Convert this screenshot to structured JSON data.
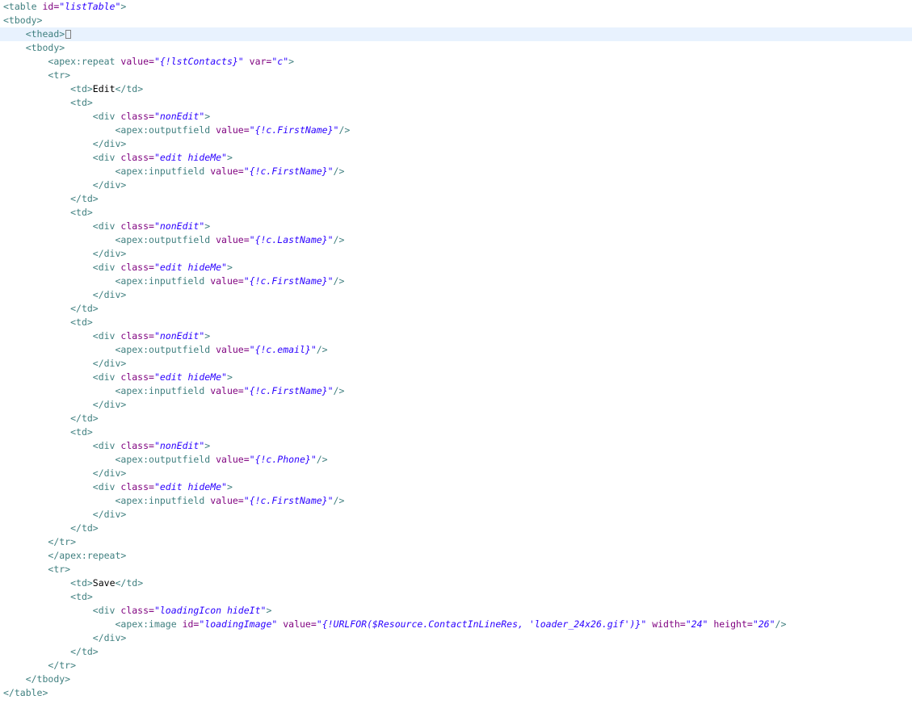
{
  "editor": {
    "current_line_index": 2,
    "lines": [
      {
        "indent": 0,
        "tokens": [
          {
            "t": "tag",
            "v": "<table "
          },
          {
            "t": "attr",
            "v": "id="
          },
          {
            "t": "val",
            "v": "\"listTable\""
          },
          {
            "t": "tag",
            "v": ">"
          }
        ]
      },
      {
        "indent": 0,
        "tokens": [
          {
            "t": "tag",
            "v": "<tbody>"
          }
        ]
      },
      {
        "indent": 1,
        "folded": true,
        "tokens": [
          {
            "t": "tag",
            "v": "<thead>"
          }
        ]
      },
      {
        "indent": 1,
        "tokens": [
          {
            "t": "tag",
            "v": "<tbody>"
          }
        ]
      },
      {
        "indent": 2,
        "tokens": [
          {
            "t": "tag",
            "v": "<apex:repeat "
          },
          {
            "t": "attr",
            "v": "value="
          },
          {
            "t": "val",
            "v": "\"{!lstContacts}\""
          },
          {
            "t": "attr",
            "v": " var="
          },
          {
            "t": "val",
            "v": "\"c\""
          },
          {
            "t": "tag",
            "v": ">"
          }
        ]
      },
      {
        "indent": 2,
        "tokens": [
          {
            "t": "tag",
            "v": "<tr>"
          }
        ]
      },
      {
        "indent": 3,
        "tokens": [
          {
            "t": "tag",
            "v": "<td>"
          },
          {
            "t": "text",
            "v": "Edit"
          },
          {
            "t": "tag",
            "v": "</td>"
          }
        ]
      },
      {
        "indent": 3,
        "tokens": [
          {
            "t": "tag",
            "v": "<td>"
          }
        ]
      },
      {
        "indent": 4,
        "tokens": [
          {
            "t": "tag",
            "v": "<div "
          },
          {
            "t": "attr",
            "v": "class="
          },
          {
            "t": "val",
            "v": "\"nonEdit\""
          },
          {
            "t": "tag",
            "v": ">"
          }
        ]
      },
      {
        "indent": 5,
        "tokens": [
          {
            "t": "tag",
            "v": "<apex:outputfield "
          },
          {
            "t": "attr",
            "v": "value="
          },
          {
            "t": "val",
            "v": "\"{!c.FirstName}\""
          },
          {
            "t": "tag",
            "v": "/>"
          }
        ]
      },
      {
        "indent": 4,
        "tokens": [
          {
            "t": "tag",
            "v": "</div>"
          }
        ]
      },
      {
        "indent": 4,
        "tokens": [
          {
            "t": "tag",
            "v": "<div "
          },
          {
            "t": "attr",
            "v": "class="
          },
          {
            "t": "val",
            "v": "\"edit hideMe\""
          },
          {
            "t": "tag",
            "v": ">"
          }
        ]
      },
      {
        "indent": 5,
        "tokens": [
          {
            "t": "tag",
            "v": "<apex:inputfield "
          },
          {
            "t": "attr",
            "v": "value="
          },
          {
            "t": "val",
            "v": "\"{!c.FirstName}\""
          },
          {
            "t": "tag",
            "v": "/>"
          }
        ]
      },
      {
        "indent": 4,
        "tokens": [
          {
            "t": "tag",
            "v": "</div>"
          }
        ]
      },
      {
        "indent": 3,
        "tokens": [
          {
            "t": "tag",
            "v": "</td>"
          }
        ]
      },
      {
        "indent": 3,
        "tokens": [
          {
            "t": "tag",
            "v": "<td>"
          }
        ]
      },
      {
        "indent": 4,
        "tokens": [
          {
            "t": "tag",
            "v": "<div "
          },
          {
            "t": "attr",
            "v": "class="
          },
          {
            "t": "val",
            "v": "\"nonEdit\""
          },
          {
            "t": "tag",
            "v": ">"
          }
        ]
      },
      {
        "indent": 5,
        "tokens": [
          {
            "t": "tag",
            "v": "<apex:outputfield "
          },
          {
            "t": "attr",
            "v": "value="
          },
          {
            "t": "val",
            "v": "\"{!c.LastName}\""
          },
          {
            "t": "tag",
            "v": "/>"
          }
        ]
      },
      {
        "indent": 4,
        "tokens": [
          {
            "t": "tag",
            "v": "</div>"
          }
        ]
      },
      {
        "indent": 4,
        "tokens": [
          {
            "t": "tag",
            "v": "<div "
          },
          {
            "t": "attr",
            "v": "class="
          },
          {
            "t": "val",
            "v": "\"edit hideMe\""
          },
          {
            "t": "tag",
            "v": ">"
          }
        ]
      },
      {
        "indent": 5,
        "tokens": [
          {
            "t": "tag",
            "v": "<apex:inputfield "
          },
          {
            "t": "attr",
            "v": "value="
          },
          {
            "t": "val",
            "v": "\"{!c.FirstName}\""
          },
          {
            "t": "tag",
            "v": "/>"
          }
        ]
      },
      {
        "indent": 4,
        "tokens": [
          {
            "t": "tag",
            "v": "</div>"
          }
        ]
      },
      {
        "indent": 3,
        "tokens": [
          {
            "t": "tag",
            "v": "</td>"
          }
        ]
      },
      {
        "indent": 3,
        "tokens": [
          {
            "t": "tag",
            "v": "<td>"
          }
        ]
      },
      {
        "indent": 4,
        "tokens": [
          {
            "t": "tag",
            "v": "<div "
          },
          {
            "t": "attr",
            "v": "class="
          },
          {
            "t": "val",
            "v": "\"nonEdit\""
          },
          {
            "t": "tag",
            "v": ">"
          }
        ]
      },
      {
        "indent": 5,
        "tokens": [
          {
            "t": "tag",
            "v": "<apex:outputfield "
          },
          {
            "t": "attr",
            "v": "value="
          },
          {
            "t": "val",
            "v": "\"{!c.email}\""
          },
          {
            "t": "tag",
            "v": "/>"
          }
        ]
      },
      {
        "indent": 4,
        "tokens": [
          {
            "t": "tag",
            "v": "</div>"
          }
        ]
      },
      {
        "indent": 4,
        "tokens": [
          {
            "t": "tag",
            "v": "<div "
          },
          {
            "t": "attr",
            "v": "class="
          },
          {
            "t": "val",
            "v": "\"edit hideMe\""
          },
          {
            "t": "tag",
            "v": ">"
          }
        ]
      },
      {
        "indent": 5,
        "tokens": [
          {
            "t": "tag",
            "v": "<apex:inputfield "
          },
          {
            "t": "attr",
            "v": "value="
          },
          {
            "t": "val",
            "v": "\"{!c.FirstName}\""
          },
          {
            "t": "tag",
            "v": "/>"
          }
        ]
      },
      {
        "indent": 4,
        "tokens": [
          {
            "t": "tag",
            "v": "</div>"
          }
        ]
      },
      {
        "indent": 3,
        "tokens": [
          {
            "t": "tag",
            "v": "</td>"
          }
        ]
      },
      {
        "indent": 3,
        "tokens": [
          {
            "t": "tag",
            "v": "<td>"
          }
        ]
      },
      {
        "indent": 4,
        "tokens": [
          {
            "t": "tag",
            "v": "<div "
          },
          {
            "t": "attr",
            "v": "class="
          },
          {
            "t": "val",
            "v": "\"nonEdit\""
          },
          {
            "t": "tag",
            "v": ">"
          }
        ]
      },
      {
        "indent": 5,
        "tokens": [
          {
            "t": "tag",
            "v": "<apex:outputfield "
          },
          {
            "t": "attr",
            "v": "value="
          },
          {
            "t": "val",
            "v": "\"{!c.Phone}\""
          },
          {
            "t": "tag",
            "v": "/>"
          }
        ]
      },
      {
        "indent": 4,
        "tokens": [
          {
            "t": "tag",
            "v": "</div>"
          }
        ]
      },
      {
        "indent": 4,
        "tokens": [
          {
            "t": "tag",
            "v": "<div "
          },
          {
            "t": "attr",
            "v": "class="
          },
          {
            "t": "val",
            "v": "\"edit hideMe\""
          },
          {
            "t": "tag",
            "v": ">"
          }
        ]
      },
      {
        "indent": 5,
        "tokens": [
          {
            "t": "tag",
            "v": "<apex:inputfield "
          },
          {
            "t": "attr",
            "v": "value="
          },
          {
            "t": "val",
            "v": "\"{!c.FirstName}\""
          },
          {
            "t": "tag",
            "v": "/>"
          }
        ]
      },
      {
        "indent": 4,
        "tokens": [
          {
            "t": "tag",
            "v": "</div>"
          }
        ]
      },
      {
        "indent": 3,
        "tokens": [
          {
            "t": "tag",
            "v": "</td>"
          }
        ]
      },
      {
        "indent": 2,
        "tokens": [
          {
            "t": "tag",
            "v": "</tr>"
          }
        ]
      },
      {
        "indent": 2,
        "tokens": [
          {
            "t": "tag",
            "v": "</apex:repeat>"
          }
        ]
      },
      {
        "indent": 2,
        "tokens": [
          {
            "t": "tag",
            "v": "<tr>"
          }
        ]
      },
      {
        "indent": 3,
        "tokens": [
          {
            "t": "tag",
            "v": "<td>"
          },
          {
            "t": "text",
            "v": "Save"
          },
          {
            "t": "tag",
            "v": "</td>"
          }
        ]
      },
      {
        "indent": 3,
        "tokens": [
          {
            "t": "tag",
            "v": "<td>"
          }
        ]
      },
      {
        "indent": 4,
        "tokens": [
          {
            "t": "tag",
            "v": "<div "
          },
          {
            "t": "attr",
            "v": "class="
          },
          {
            "t": "val",
            "v": "\"loadingIcon hideIt\""
          },
          {
            "t": "tag",
            "v": ">"
          }
        ]
      },
      {
        "indent": 5,
        "tokens": [
          {
            "t": "tag",
            "v": "<apex:image "
          },
          {
            "t": "attr",
            "v": "id="
          },
          {
            "t": "val",
            "v": "\"loadingImage\""
          },
          {
            "t": "attr",
            "v": " value="
          },
          {
            "t": "val",
            "v": "\"{!URLFOR($Resource.ContactInLineRes, 'loader_24x26.gif')}\""
          },
          {
            "t": "attr",
            "v": " width="
          },
          {
            "t": "val",
            "v": "\"24\""
          },
          {
            "t": "attr",
            "v": " height="
          },
          {
            "t": "val",
            "v": "\"26\""
          },
          {
            "t": "tag",
            "v": "/>"
          }
        ]
      },
      {
        "indent": 4,
        "tokens": [
          {
            "t": "tag",
            "v": "</div>"
          }
        ]
      },
      {
        "indent": 3,
        "tokens": [
          {
            "t": "tag",
            "v": "</td>"
          }
        ]
      },
      {
        "indent": 2,
        "tokens": [
          {
            "t": "tag",
            "v": "</tr>"
          }
        ]
      },
      {
        "indent": 1,
        "tokens": [
          {
            "t": "tag",
            "v": "</tbody>"
          }
        ]
      },
      {
        "indent": 0,
        "tokens": [
          {
            "t": "tag",
            "v": "</table>"
          }
        ]
      }
    ]
  }
}
